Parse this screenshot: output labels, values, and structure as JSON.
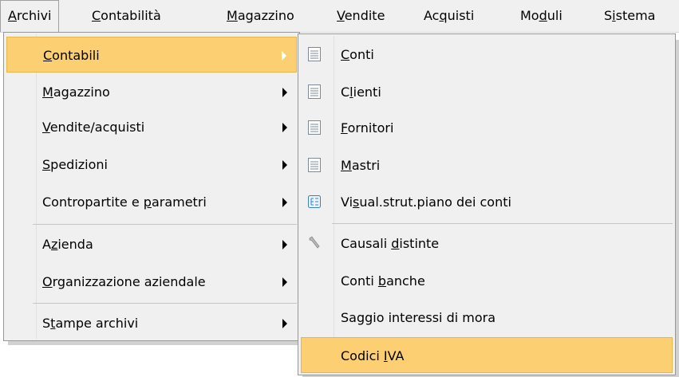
{
  "menubar": {
    "items": [
      {
        "label": "Archivi",
        "pre": "",
        "ul": "A",
        "post": "rchivi"
      },
      {
        "label": "Contabilità",
        "pre": "",
        "ul": "C",
        "post": "ontabilità"
      },
      {
        "label": "Magazzino",
        "pre": "",
        "ul": "M",
        "post": "agazzino"
      },
      {
        "label": "Vendite",
        "pre": "",
        "ul": "V",
        "post": "endite"
      },
      {
        "label": "Acquisti",
        "pre": "Ac",
        "ul": "q",
        "post": "uisti"
      },
      {
        "label": "Moduli",
        "pre": "Mo",
        "ul": "d",
        "post": "uli"
      },
      {
        "label": "Sistema",
        "pre": "S",
        "ul": "i",
        "post": "stema"
      }
    ]
  },
  "archivi_menu": {
    "items": [
      {
        "label": "Contabili",
        "pre": "",
        "ul": "C",
        "post": "ontabili",
        "submenu": true,
        "highlighted": true
      },
      {
        "label": "Magazzino",
        "pre": "",
        "ul": "M",
        "post": "agazzino",
        "submenu": true
      },
      {
        "label": "Vendite/acquisti",
        "pre": "",
        "ul": "V",
        "post": "endite/acquisti",
        "submenu": true
      },
      {
        "label": "Spedizioni",
        "pre": "",
        "ul": "S",
        "post": "pedizioni",
        "submenu": true
      },
      {
        "label": "Contropartite e parametri",
        "pre": "Contropartite e ",
        "ul": "p",
        "post": "arametri",
        "submenu": true
      },
      {
        "label": "Azienda",
        "pre": "A",
        "ul": "z",
        "post": "ienda",
        "submenu": true
      },
      {
        "label": "Organizzazione aziendale",
        "pre": "",
        "ul": "O",
        "post": "rganizzazione aziendale",
        "submenu": true
      },
      {
        "label": "Stampe archivi",
        "pre": "S",
        "ul": "t",
        "post": "ampe archivi",
        "submenu": true
      }
    ]
  },
  "contabili_menu": {
    "items": [
      {
        "label": "Conti",
        "pre": "",
        "ul": "C",
        "post": "onti",
        "icon": "list-icon"
      },
      {
        "label": "Clienti",
        "pre": "C",
        "ul": "l",
        "post": "ienti",
        "icon": "list-icon"
      },
      {
        "label": "Fornitori",
        "pre": "",
        "ul": "F",
        "post": "ornitori",
        "icon": "list-icon"
      },
      {
        "label": "Mastri",
        "pre": "",
        "ul": "M",
        "post": "astri",
        "icon": "list-icon"
      },
      {
        "label": "Visual.strut.piano dei conti",
        "pre": "Vi",
        "ul": "s",
        "post": "ual.strut.piano dei conti",
        "icon": "tree-icon"
      },
      {
        "label": "Causali distinte",
        "pre": "Causali ",
        "ul": "d",
        "post": "istinte",
        "icon": "wrench-icon"
      },
      {
        "label": "Conti banche",
        "pre": "Conti ",
        "ul": "b",
        "post": "anche",
        "icon": ""
      },
      {
        "label": "Saggio interessi di mora",
        "pre": "Saggio interessi di mora",
        "ul": "",
        "post": "",
        "icon": ""
      },
      {
        "label": "Codici IVA",
        "pre": "Codici ",
        "ul": "I",
        "post": "VA",
        "icon": "",
        "highlighted": true
      }
    ]
  },
  "colors": {
    "highlight": "#fcd072",
    "highlight_border": "#e5b64a",
    "menu_bg": "#f0f0f0"
  }
}
